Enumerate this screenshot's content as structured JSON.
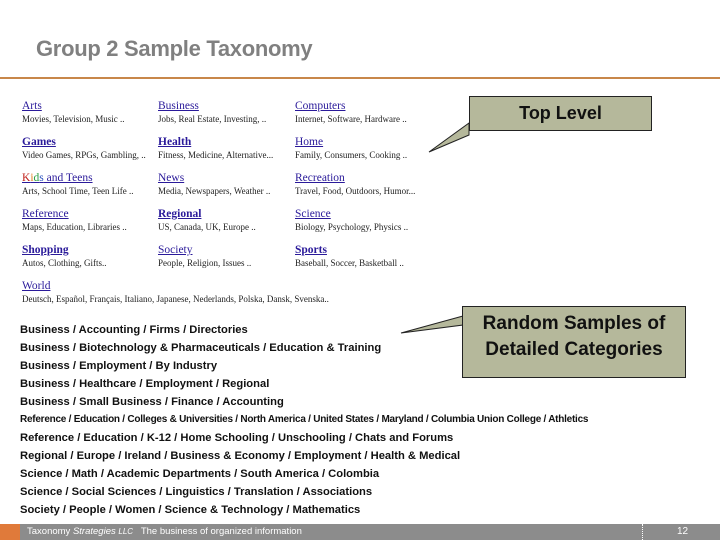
{
  "slide": {
    "title": "Group 2 Sample Taxonomy"
  },
  "directory": {
    "categories": [
      {
        "name": "Arts",
        "subs": "Movies, Television, Music .."
      },
      {
        "name": "Business",
        "subs": "Jobs, Real Estate, Investing, .."
      },
      {
        "name": "Computers",
        "subs": "Internet, Software, Hardware .."
      },
      {
        "name": "Games",
        "subs": "Video Games, RPGs, Gambling, .."
      },
      {
        "name": "Health",
        "subs": "Fitness, Medicine, Alternative..."
      },
      {
        "name": "Home",
        "subs": "Family, Consumers, Cooking .."
      },
      {
        "name_parts": [
          "K",
          "i",
          "d",
          "s",
          " and Teens"
        ],
        "name": "Kids and Teens",
        "subs": "Arts, School Time, Teen Life .."
      },
      {
        "name": "News",
        "subs": "Media, Newspapers, Weather .."
      },
      {
        "name": "Recreation",
        "subs": "Travel, Food, Outdoors, Humor..."
      },
      {
        "name": "Reference",
        "subs": "Maps, Education, Libraries .."
      },
      {
        "name": "Regional",
        "subs": "US, Canada, UK, Europe .."
      },
      {
        "name": "Science",
        "subs": "Biology, Psychology, Physics .."
      },
      {
        "name": "Shopping",
        "subs": "Autos, Clothing, Gifts.."
      },
      {
        "name": "Society",
        "subs": "People, Religion, Issues .."
      },
      {
        "name": "Sports",
        "subs": "Baseball, Soccer, Basketball .."
      },
      {
        "name": "World",
        "subs": "Deutsch, Español, Français, Italiano, Japanese, Nederlands, Polska, Dansk, Svenska.."
      }
    ]
  },
  "callouts": {
    "top_level": "Top Level",
    "random_line1": "Random Samples of",
    "random_line2": "Detailed Categories"
  },
  "samples": [
    "Business / Accounting / Firms / Directories",
    "Business / Biotechnology &  Pharmaceuticals / Education & Training",
    "Business / Employment / By Industry",
    "Business / Healthcare / Employment / Regional",
    "Business / Small Business / Finance / Accounting",
    "Reference / Education / Colleges & Universities / North America / United States / Maryland / Columbia Union College / Athletics",
    "Reference / Education / K-12 / Home Schooling / Unschooling / Chats and Forums",
    "Regional / Europe / Ireland / Business & Economy / Employment / Health & Medical",
    "Science / Math / Academic Departments / South America / Colombia",
    "Science / Social Sciences / Linguistics / Translation / Associations",
    "Society / People / Women / Science & Technology / Mathematics"
  ],
  "footer": {
    "company": "Taxonomy",
    "company_italic": "Strategies",
    "company_suffix": "LLC",
    "tagline": "The business of organized information",
    "page_number": "12"
  },
  "colors": {
    "rule": "#c8874a",
    "link": "#2a1a9a",
    "callout_fill": "#b5b89b",
    "footer_bg": "#8c8c8c",
    "footer_accent": "#e07a3a"
  }
}
